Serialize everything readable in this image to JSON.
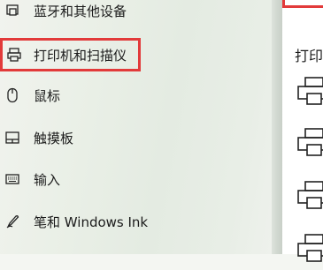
{
  "sidebar": {
    "items": [
      {
        "label": "蓝牙和其他设备",
        "icon": "bluetooth-devices-icon"
      },
      {
        "label": "打印机和扫描仪",
        "icon": "printer-icon",
        "selected": true
      },
      {
        "label": "鼠标",
        "icon": "mouse-icon"
      },
      {
        "label": "触摸板",
        "icon": "touchpad-icon"
      },
      {
        "label": "输入",
        "icon": "keyboard-icon"
      },
      {
        "label": "笔和 Windows Ink",
        "icon": "pen-icon"
      }
    ]
  },
  "main": {
    "heading": "打印"
  },
  "colors": {
    "highlight": "#e23a3a"
  }
}
